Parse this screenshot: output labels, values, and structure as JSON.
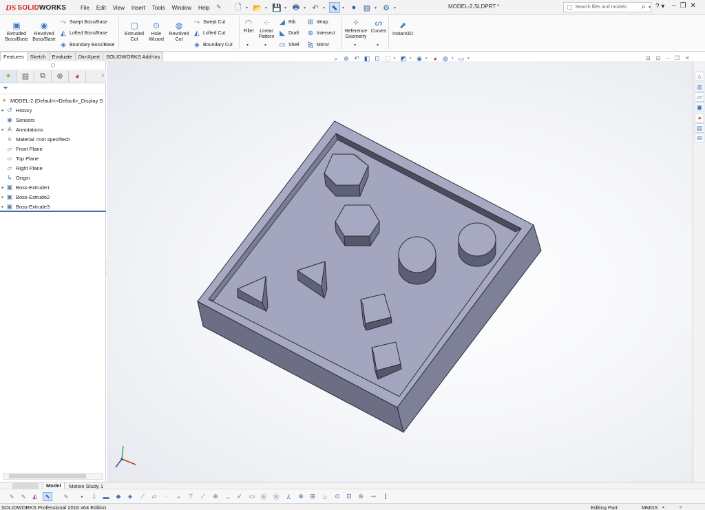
{
  "app": {
    "logo_ds": "DS",
    "logo_solid": "SOLID",
    "logo_works": "WORKS",
    "document_title": "MODEL-2.SLDPRT *"
  },
  "menu": [
    "File",
    "Edit",
    "View",
    "Insert",
    "Tools",
    "Window",
    "Help"
  ],
  "search": {
    "placeholder": "Search files and models"
  },
  "ribbon": {
    "extruded_boss": "Extruded Boss/Base",
    "revolved_boss": "Revolved Boss/Base",
    "swept_boss": "Swept Boss/Base",
    "lofted_boss": "Lofted Boss/Base",
    "boundary_boss": "Boundary Boss/Base",
    "extruded_cut": "Extruded Cut",
    "hole_wizard": "Hole Wizard",
    "revolved_cut": "Revolved Cut",
    "swept_cut": "Swept Cut",
    "lofted_cut": "Lofted Cut",
    "boundary_cut": "Boundary Cut",
    "fillet": "Fillet",
    "linear_pattern": "Linear Pattern",
    "rib": "Rib",
    "draft": "Draft",
    "shell": "Shell",
    "wrap": "Wrap",
    "intersect": "Intersect",
    "mirror": "Mirror",
    "reference_geometry": "Reference Geometry",
    "curves": "Curves",
    "instant3d": "Instant3D"
  },
  "command_tabs": [
    {
      "label": "Features",
      "active": true
    },
    {
      "label": "Sketch",
      "active": false
    },
    {
      "label": "Evaluate",
      "active": false
    },
    {
      "label": "DimXpert",
      "active": false
    },
    {
      "label": "SOLIDWORKS Add-Ins",
      "active": false
    }
  ],
  "feature_tree": {
    "root": "MODEL-2  (Default<<Default>_Display S",
    "items": [
      {
        "label": "History",
        "expandable": true,
        "icon": "history-icon"
      },
      {
        "label": "Sensors",
        "expandable": false,
        "icon": "sensors-icon"
      },
      {
        "label": "Annotations",
        "expandable": true,
        "icon": "annotations-icon"
      },
      {
        "label": "Material <not specified>",
        "expandable": false,
        "icon": "material-icon"
      },
      {
        "label": "Front Plane",
        "expandable": false,
        "icon": "plane-icon"
      },
      {
        "label": "Top Plane",
        "expandable": false,
        "icon": "plane-icon"
      },
      {
        "label": "Right Plane",
        "expandable": false,
        "icon": "plane-icon"
      },
      {
        "label": "Origin",
        "expandable": false,
        "icon": "origin-icon"
      },
      {
        "label": "Boss-Extrude1",
        "expandable": true,
        "icon": "extrude-icon"
      },
      {
        "label": "Boss-Extrude2",
        "expandable": true,
        "icon": "extrude-icon"
      },
      {
        "label": "Boss-Extrude3",
        "expandable": true,
        "icon": "extrude-icon"
      }
    ]
  },
  "bottom_tabs": [
    {
      "label": "Model",
      "active": true
    },
    {
      "label": "Motion Study 1",
      "active": false
    }
  ],
  "status": {
    "edition": "SOLIDWORKS Professional 2016 x64 Edition",
    "mode": "Editing Part",
    "units": "MMGS"
  },
  "colors": {
    "model_top": "#a6a9c1",
    "model_left_side": "#6b6e82",
    "model_right_side": "#7c7f95",
    "accent": "#3d78c2",
    "brand": "#d61f26"
  }
}
